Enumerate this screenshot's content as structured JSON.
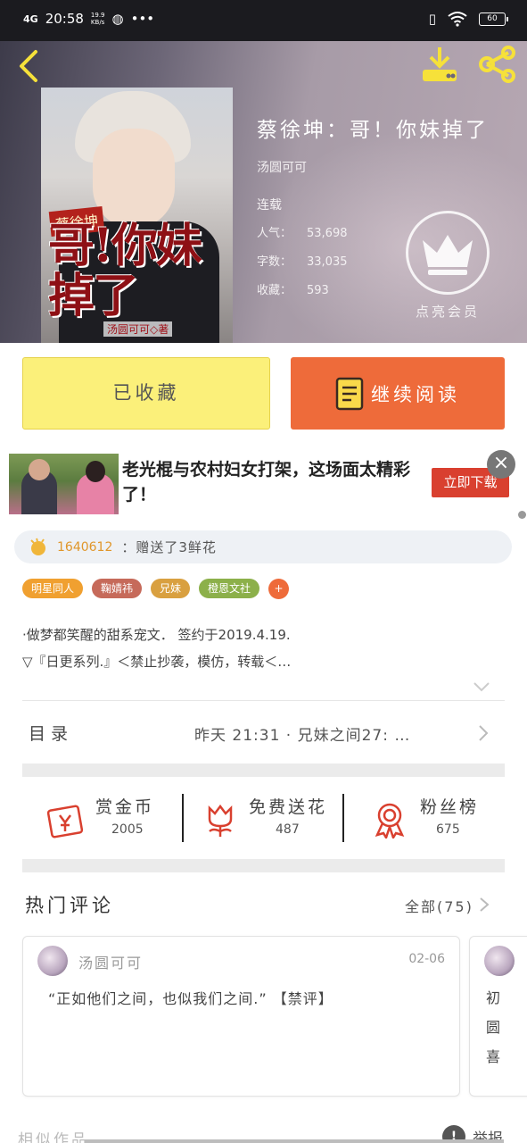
{
  "status_bar": {
    "signal": "4G",
    "time": "20:58",
    "net_speed_value": "19.9",
    "net_speed_unit": "KB/s",
    "more": "•••",
    "battery": "60"
  },
  "book": {
    "title": "蔡徐坤：哥！你妹掉了",
    "author": "汤圆可可",
    "status": "连载",
    "stats": [
      {
        "label": "人气：",
        "value": "53,698"
      },
      {
        "label": "字数：",
        "value": "33,035"
      },
      {
        "label": "收藏：",
        "value": "593"
      }
    ],
    "vip_label": "点亮会员",
    "cover": {
      "banner": "蔡徐坤",
      "title": "哥!你妹掉了",
      "author": "汤圆可可◇著"
    }
  },
  "buttons": {
    "collected": "已收藏",
    "continue_reading": "继续阅读"
  },
  "ad": {
    "text": "老光棍与农村妇女打架，这场面太精彩了！",
    "cta": "立即下载",
    "close": "×"
  },
  "gift": {
    "user": "1640612",
    "message": "：赠送了3鲜花"
  },
  "tags": [
    {
      "label": "明星同人",
      "color": "#f0a030"
    },
    {
      "label": "鞠婧祎",
      "color": "#c66a5a"
    },
    {
      "label": "兄妹",
      "color": "#d9a040"
    },
    {
      "label": "橙恩文社",
      "color": "#8cb04a"
    }
  ],
  "tag_add": "+",
  "description": [
    "·做梦都笑醒的甜系宠文．  签约于2019.4.19.",
    "▽『日更系列.』＜禁止抄袭，模仿，转载＜…"
  ],
  "toc": {
    "label": "目录",
    "latest": "昨天 21:31 · 兄妹之间27: …"
  },
  "actions": [
    {
      "name": "赏金币",
      "count": "2005",
      "icon": "coin-envelope-icon"
    },
    {
      "name": "免费送花",
      "count": "487",
      "icon": "flower-icon"
    },
    {
      "name": "粉丝榜",
      "count": "675",
      "icon": "medal-icon"
    }
  ],
  "comments": {
    "title": "热门评论",
    "all": "全部(75)",
    "items": [
      {
        "user": "汤圆可可",
        "date": "02-06",
        "text": "“正如他们之间，也似我们之间.”  【禁评】"
      },
      {
        "vertical_text": "初圆喜"
      }
    ]
  },
  "footer": {
    "similar": "相似作品",
    "report": "举报",
    "report_icon": "!"
  },
  "colors": {
    "accent": "#ee6b3a",
    "collected_bg": "#fbf07a",
    "gift_user": "#e0962a",
    "ad_cta": "#d9402f"
  }
}
